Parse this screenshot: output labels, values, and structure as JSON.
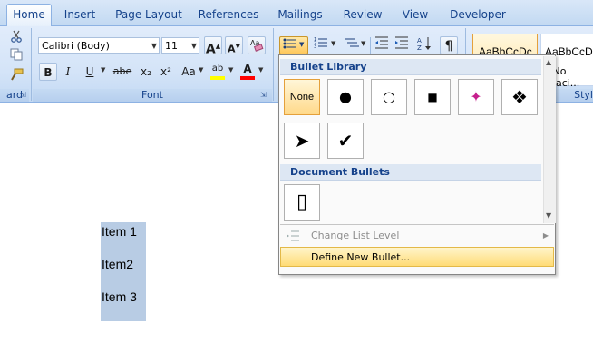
{
  "ribbon": {
    "tabs": [
      "Home",
      "Insert",
      "Page Layout",
      "References",
      "Mailings",
      "Review",
      "View",
      "Developer"
    ],
    "active_tab": "Home",
    "clipboard_label_partial": "ard",
    "font_group_label": "Font",
    "font_name": "Calibri (Body)",
    "font_size": "11",
    "grow_font": "A",
    "shrink_font": "A",
    "bold": "B",
    "italic": "I",
    "underline": "U",
    "strikethrough": "abe",
    "subscript": "x₂",
    "superscript": "x²",
    "change_case": "Aa",
    "highlight": "ab",
    "font_color": "A",
    "paragraph_mark": "¶",
    "styles": {
      "normal_preview": "AaBbCcDc",
      "nospacing_preview": "AaBbCcD",
      "nospacing_label": "¶ No Spaci...",
      "group_label_partial": "Styl"
    }
  },
  "bullet_dropdown": {
    "library_header": "Bullet Library",
    "none_label": "None",
    "library_glyphs": [
      "●",
      "○",
      "■",
      "✦",
      "❖",
      "➤",
      "✔"
    ],
    "document_header": "Document Bullets",
    "document_glyphs": [
      "▯"
    ],
    "change_list_level": "Change List Level",
    "define_new_bullet": "Define New Bullet..."
  },
  "document": {
    "items": [
      "Item 1",
      "Item2",
      "Item 3"
    ]
  },
  "colors": {
    "ribbon_text": "#15428b",
    "selection": "#b8cce4",
    "highlight_menu": "#ffdb75",
    "font_color_underline": "#ff0000",
    "highlight_color": "#ffff00"
  }
}
